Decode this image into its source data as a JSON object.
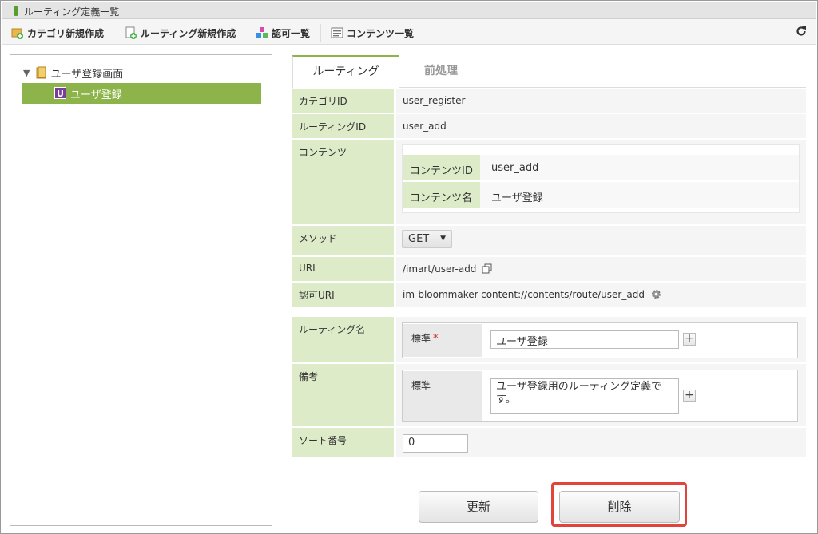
{
  "window": {
    "title": "ルーティング定義一覧"
  },
  "toolbar": {
    "new_category": "カテゴリ新規作成",
    "new_routing": "ルーティング新規作成",
    "permissions": "認可一覧",
    "contents": "コンテンツ一覧"
  },
  "tree": {
    "root": "ユーザ登録画面",
    "child_badge": "U",
    "child": "ユーザ登録"
  },
  "tabs": {
    "routing": "ルーティング",
    "preprocess": "前処理"
  },
  "form": {
    "category_id": {
      "label": "カテゴリID",
      "value": "user_register"
    },
    "routing_id": {
      "label": "ルーティングID",
      "value": "user_add"
    },
    "contents": {
      "label": "コンテンツ",
      "content_id_label": "コンテンツID",
      "content_id": "user_add",
      "content_name_label": "コンテンツ名",
      "content_name": "ユーザ登録"
    },
    "method": {
      "label": "メソッド",
      "value": "GET"
    },
    "url": {
      "label": "URL",
      "value": "/imart/user-add"
    },
    "auth_uri": {
      "label": "認可URI",
      "value": "im-bloommaker-content://contents/route/user_add"
    },
    "routing_name": {
      "label": "ルーティング名",
      "lang_label": "標準",
      "required_mark": "*",
      "value": "ユーザ登録"
    },
    "remarks": {
      "label": "備考",
      "lang_label": "標準",
      "value": "ユーザ登録用のルーティング定義です。"
    },
    "sort_no": {
      "label": "ソート番号",
      "value": "0"
    }
  },
  "buttons": {
    "update": "更新",
    "delete": "削除"
  },
  "colors": {
    "accent": "#8cb44a",
    "label_bg": "#deebc8",
    "highlight": "#e0443a"
  },
  "icons": [
    "category-add-icon",
    "routing-add-icon",
    "permission-icon",
    "contents-list-icon",
    "refresh-icon",
    "folder-icon",
    "copy-icon",
    "gear-icon",
    "plus-icon"
  ]
}
